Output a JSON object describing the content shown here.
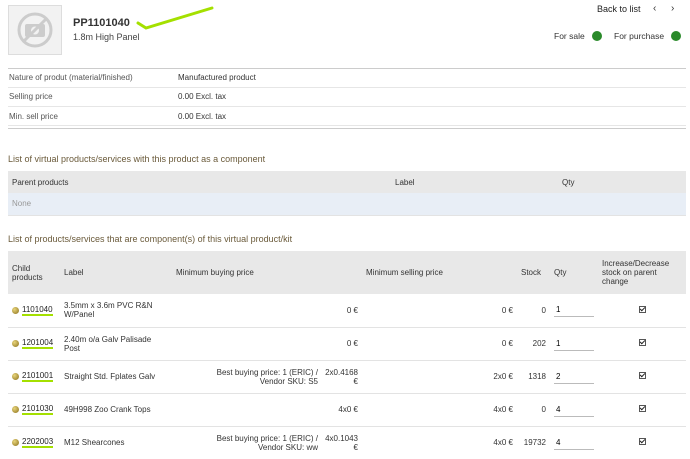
{
  "header": {
    "ref": "PP1101040",
    "description": "1.8m High Panel",
    "back_to_list": "Back to list",
    "prev_icon": "chevron-left-icon",
    "next_icon": "chevron-right-icon",
    "prev_glyph": "‹",
    "next_glyph": "›",
    "for_sale": "For sale",
    "for_purchase": "For purchase",
    "status_color": "#2a8a2a",
    "annotation_color": "#a4e000"
  },
  "info": [
    {
      "key": "Nature of produt (material/finished)",
      "value": "Manufactured product"
    },
    {
      "key": "Selling price",
      "value": "0.00 Excl. tax"
    },
    {
      "key": "Min. sell price",
      "value": "0.00 Excl. tax"
    }
  ],
  "parents": {
    "title": "List of virtual products/services with this product as a component",
    "headers": {
      "parent": "Parent products",
      "label": "Label",
      "qty": "Qty"
    },
    "empty": "None"
  },
  "components": {
    "title": "List of products/services that are component(s) of this virtual product/kit",
    "headers": {
      "child": "Child products",
      "label": "Label",
      "min_buy": "Minimum buying price",
      "min_sell": "Minimum selling price",
      "stock": "Stock",
      "qty": "Qty",
      "incdec": "Increase/Decrease stock on parent change"
    },
    "rows": [
      {
        "ref": "1101040",
        "label": "3.5mm x 3.6m PVC R&N W/Panel",
        "buy_note": "",
        "buy_vendor": "",
        "buy_price": "0 €",
        "sell": "0 €",
        "stock": "0",
        "qty": "1"
      },
      {
        "ref": "1201004",
        "label": "2.40m o/a Galv Palisade Post",
        "buy_note": "",
        "buy_vendor": "",
        "buy_price": "0 €",
        "sell": "0 €",
        "stock": "202",
        "qty": "1"
      },
      {
        "ref": "2101001",
        "label": "Straight Std. Fplates Galv",
        "buy_note": "Best buying price: 1 (ERIC) /",
        "buy_vendor": "Vendor SKU: S5",
        "buy_price": "2x0.4168 €",
        "sell": "2x0 €",
        "stock": "1318",
        "qty": "2"
      },
      {
        "ref": "2101030",
        "label": "49H998 Zoo Crank Tops",
        "buy_note": "",
        "buy_vendor": "",
        "buy_price": "4x0 €",
        "sell": "4x0 €",
        "stock": "0",
        "qty": "4"
      },
      {
        "ref": "2202003",
        "label": "M12 Shearcones",
        "buy_note": "Best buying price: 1 (ERIC) /",
        "buy_vendor": "Vendor SKU: ww",
        "buy_price": "4x0.1043 €",
        "sell": "4x0 €",
        "stock": "19732",
        "qty": "4"
      }
    ]
  }
}
